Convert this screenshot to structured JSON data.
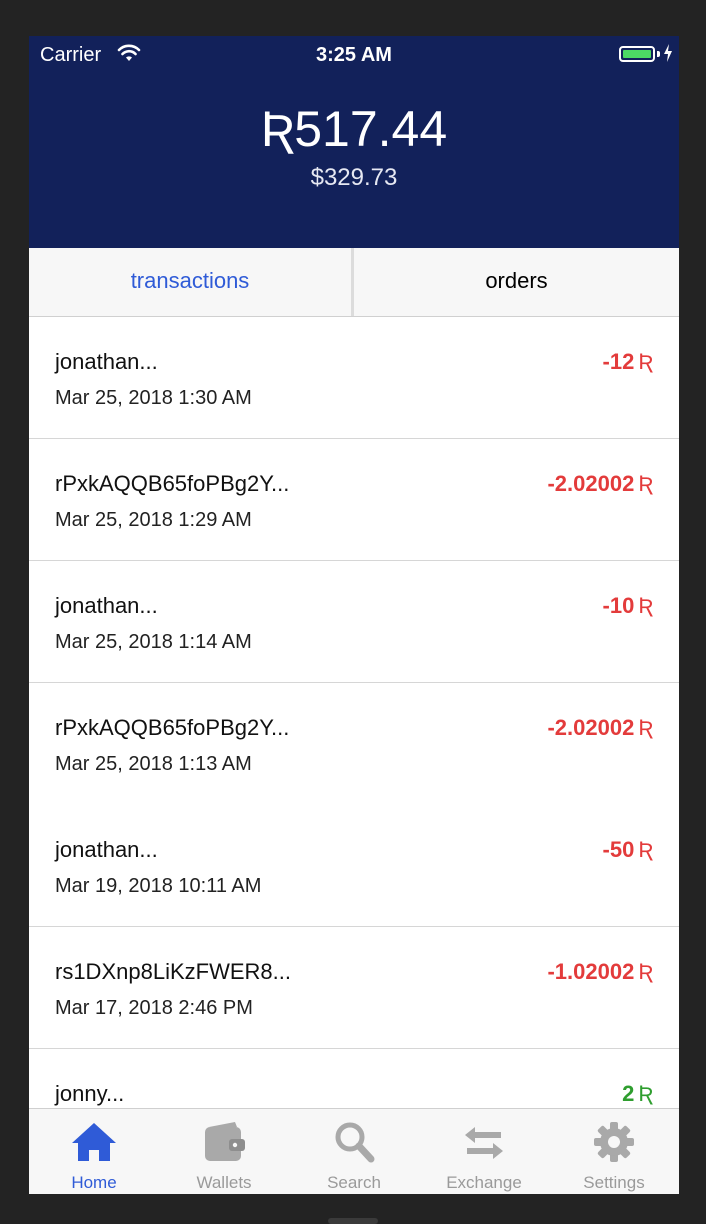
{
  "status": {
    "carrier": "Carrier",
    "time": "3:25 AM"
  },
  "header": {
    "balance": "Ʀ517.44",
    "balance_usd": "$329.73"
  },
  "tabs": [
    {
      "label": "transactions"
    },
    {
      "label": "orders"
    }
  ],
  "transactions": [
    {
      "name": "jonathan...",
      "date": "Mar 25, 2018 1:30 AM",
      "amount": "-12",
      "currency": "Ʀ"
    },
    {
      "name": "rPxkAQQB65foPBg2Y...",
      "date": "Mar 25, 2018 1:29 AM",
      "amount": "-2.02002",
      "currency": "Ʀ"
    },
    {
      "name": "jonathan...",
      "date": "Mar 25, 2018 1:14 AM",
      "amount": "-10",
      "currency": "Ʀ"
    },
    {
      "name": "rPxkAQQB65foPBg2Y...",
      "date": "Mar 25, 2018 1:13 AM",
      "amount": "-2.02002",
      "currency": "Ʀ"
    },
    {
      "name": "jonathan...",
      "date": "Mar 19, 2018 10:11 AM",
      "amount": "-50",
      "currency": "Ʀ"
    },
    {
      "name": "rs1DXnp8LiKzFWER8...",
      "date": "Mar 17, 2018 2:46 PM",
      "amount": "-1.02002",
      "currency": "Ʀ"
    },
    {
      "name": "jonny...",
      "date": "",
      "amount": "2",
      "currency": "Ʀ"
    }
  ],
  "tabbar": [
    {
      "label": "Home",
      "icon": "home-icon"
    },
    {
      "label": "Wallets",
      "icon": "wallet-icon"
    },
    {
      "label": "Search",
      "icon": "search-icon"
    },
    {
      "label": "Exchange",
      "icon": "exchange-icon"
    },
    {
      "label": "Settings",
      "icon": "gear-icon"
    }
  ],
  "colors": {
    "header": "#12215a",
    "accent": "#2f5bd7",
    "negative": "#e33b3b",
    "positive": "#2f9e2f"
  }
}
